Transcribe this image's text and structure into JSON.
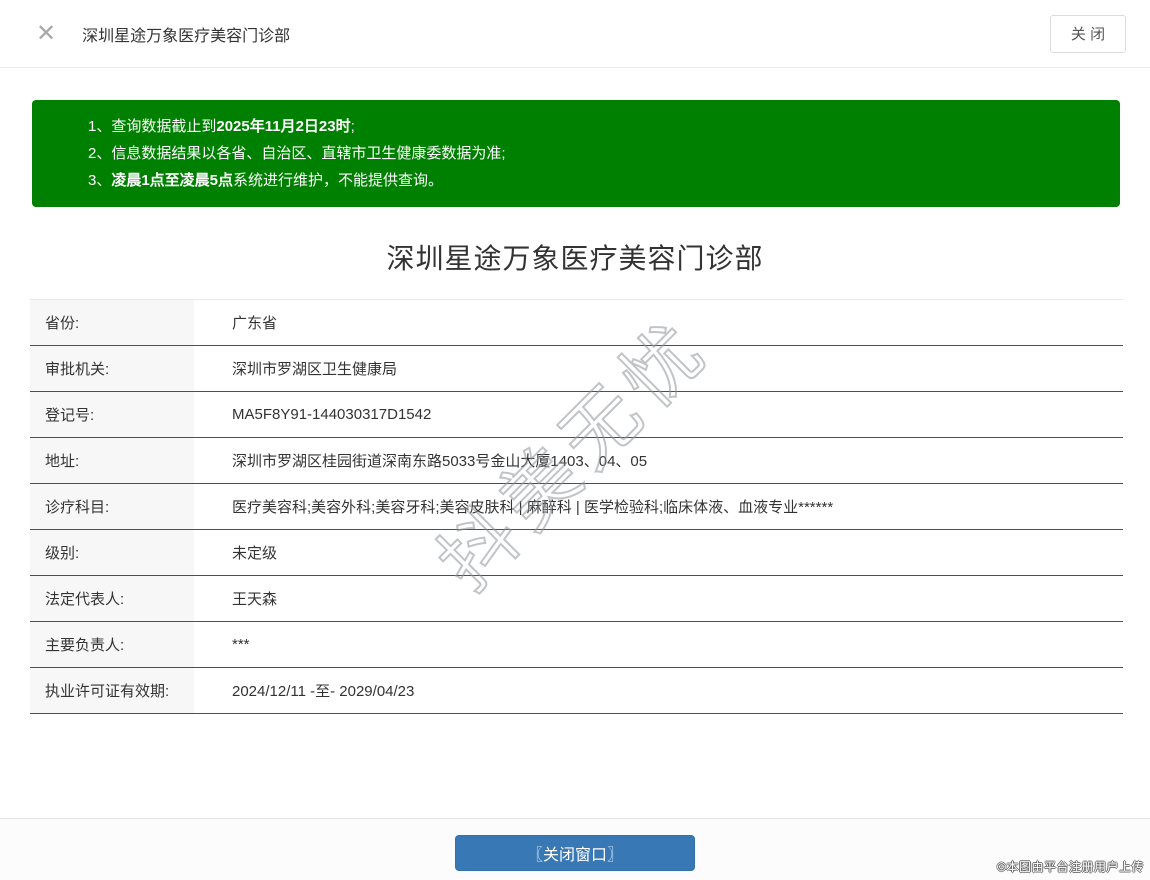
{
  "colors": {
    "notice_green": "#008000",
    "table_divider_teal": "#2e5f57",
    "primary_button_blue": "#3878b4"
  },
  "header": {
    "close_icon": "✕",
    "title": "深圳星途万象医疗美容门诊部",
    "close_button_label": "关 闭"
  },
  "notice": {
    "lines": [
      {
        "num": "1、",
        "pre": "查询数据截止到",
        "bold": "2025年11月2日23时",
        "post": ";"
      },
      {
        "num": "2、",
        "pre": "信息数据结果以各省、自治区、直辖市卫生健康委数据为准;",
        "bold": "",
        "post": ""
      },
      {
        "num": "3、",
        "pre": "",
        "bold": "凌晨1点至凌晨5点",
        "post": "系统进行维护，不能提供查询。"
      }
    ]
  },
  "page_title": "深圳星途万象医疗美容门诊部",
  "table": {
    "rows": [
      {
        "label": "省份:",
        "value": "广东省"
      },
      {
        "label": "审批机关:",
        "value": "深圳市罗湖区卫生健康局"
      },
      {
        "label": "登记号:",
        "value": "MA5F8Y91-144030317D1542"
      },
      {
        "label": "地址:",
        "value": "深圳市罗湖区桂园街道深南东路5033号金山大厦1403、04、05"
      },
      {
        "label": "诊疗科目:",
        "value": "医疗美容科;美容外科;美容牙科;美容皮肤科 | 麻醉科 | 医学检验科;临床体液、血液专业******"
      },
      {
        "label": "级别:",
        "value": "未定级"
      },
      {
        "label": "法定代表人:",
        "value": "王天森"
      },
      {
        "label": "主要负责人:",
        "value": "***"
      },
      {
        "label": "执业许可证有效期:",
        "value": "2024/12/11 -至- 2029/04/23"
      }
    ]
  },
  "watermark": {
    "text": "抖美无忧"
  },
  "footer": {
    "close_window_button": "〖关闭窗口〗",
    "copyright": "©本图由平台注册用户上传"
  }
}
